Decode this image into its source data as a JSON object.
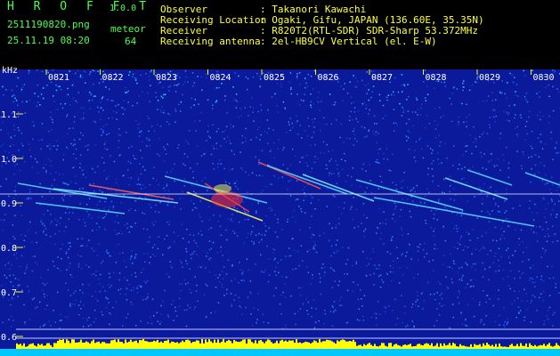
{
  "header": {
    "brand": "H R O F F T",
    "version": "1.0.0",
    "filename": "2511190820.png",
    "timestamp": "25.11.19 08:20",
    "meteor_label": "meteor",
    "meteor_count": "64",
    "info": [
      {
        "key": "Observer",
        "value": ": Takanori Kawachi"
      },
      {
        "key": "Receiving Location",
        "value": ": Ogaki, Gifu, JAPAN (136.60E, 35.35N)"
      },
      {
        "key": "Receiver",
        "value": ": R820T2(RTL-SDR) SDR-Sharp 53.372MHz"
      },
      {
        "key": "Receiving antenna",
        "value": ": 2el-HB9CV Vertical (el. E-W)"
      }
    ]
  },
  "spectrogram": {
    "unit": "kHz",
    "time_labels": [
      "0821",
      "0822",
      "0823",
      "0824",
      "0825",
      "0826",
      "0827",
      "0828",
      "0829",
      "0830"
    ],
    "freq_labels": [
      "1.1",
      "1.0",
      "0.9",
      "0.8",
      "0.7",
      "0.6"
    ],
    "freq_values": [
      1.1,
      1.0,
      0.9,
      0.8,
      0.7,
      0.6
    ],
    "carrier_khz": 0.92,
    "colors": {
      "background": "#0a1a9a",
      "tick_label": "#ffffff",
      "tick": "#ffff00",
      "level_bar": "#ffff00",
      "carrier": "#ff3030"
    }
  }
}
